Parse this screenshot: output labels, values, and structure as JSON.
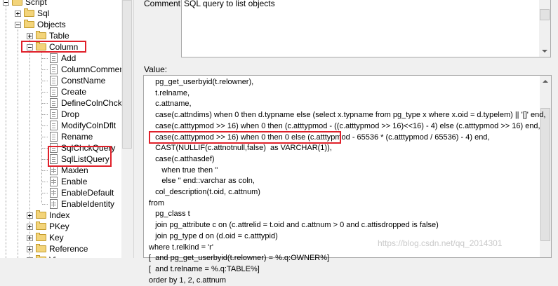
{
  "tree": {
    "items": [
      {
        "label": "Script",
        "kind": "folder"
      },
      {
        "label": "Sql",
        "kind": "folder"
      },
      {
        "label": "Objects",
        "kind": "folder"
      },
      {
        "label": "Table",
        "kind": "folder"
      },
      {
        "label": "Column",
        "kind": "folder"
      },
      {
        "label": "Add",
        "kind": "doc"
      },
      {
        "label": "ColumnComment",
        "kind": "doc"
      },
      {
        "label": "ConstName",
        "kind": "doc"
      },
      {
        "label": "Create",
        "kind": "doc"
      },
      {
        "label": "DefineColnChck",
        "kind": "doc"
      },
      {
        "label": "Drop",
        "kind": "doc"
      },
      {
        "label": "ModifyColnDflt",
        "kind": "doc"
      },
      {
        "label": "Rename",
        "kind": "doc"
      },
      {
        "label": "SqlChckQuery",
        "kind": "doc"
      },
      {
        "label": "SqlListQuery",
        "kind": "doc"
      },
      {
        "label": "Maxlen",
        "kind": "grid"
      },
      {
        "label": "Enable",
        "kind": "grid"
      },
      {
        "label": "EnableDefault",
        "kind": "grid"
      },
      {
        "label": "EnableIdentity",
        "kind": "grid"
      },
      {
        "label": "Index",
        "kind": "folder"
      },
      {
        "label": "PKey",
        "kind": "folder"
      },
      {
        "label": "Key",
        "kind": "folder"
      },
      {
        "label": "Reference",
        "kind": "folder"
      },
      {
        "label": "View",
        "kind": "folder"
      }
    ]
  },
  "comment": {
    "label": "Comment:",
    "value": "SQL query to list objects"
  },
  "value": {
    "label": "Value:",
    "lines": [
      "   pg_get_userbyid(t.relowner),",
      "   t.relname,",
      "   c.attname,",
      "   case(c.attndims) when 0 then d.typname else (select x.typname from pg_type x where x.oid = d.typelem) || '[]' end,",
      "   case(c.atttypmod >> 16) when 0 then (c.atttypmod - ((c.atttypmod >> 16)<<16) - 4) else (c.atttypmod >> 16) end,",
      "   case(c.atttypmod >> 16) when 0 then 0 else (c.atttypmod - 65536 * (c.atttypmod / 65536) - 4) end,",
      "   CAST(NULLIF(c.attnotnull,false)  as VARCHAR(1)),",
      "   case(c.atthasdef)",
      "      when true then ''",
      "      else '' end::varchar as coln,",
      "   col_description(t.oid, c.attnum)",
      "from",
      "   pg_class t",
      "   join pg_attribute c on (c.attrelid = t.oid and c.attnum > 0 and c.attisdropped is false)",
      "   join pg_type d on (d.oid = c.atttypid)",
      "where t.relkind = 'r'",
      "[  and pg_get_userbyid(t.relowner) = %.q:OWNER%]",
      "[  and t.relname = %.q:TABLE%]",
      "order by 1, 2, c.attnum"
    ]
  },
  "watermark": "https://blog.csdn.net/qq_2014301",
  "colors": {
    "highlight": "#e0202a",
    "folder": "#f3d47a"
  }
}
